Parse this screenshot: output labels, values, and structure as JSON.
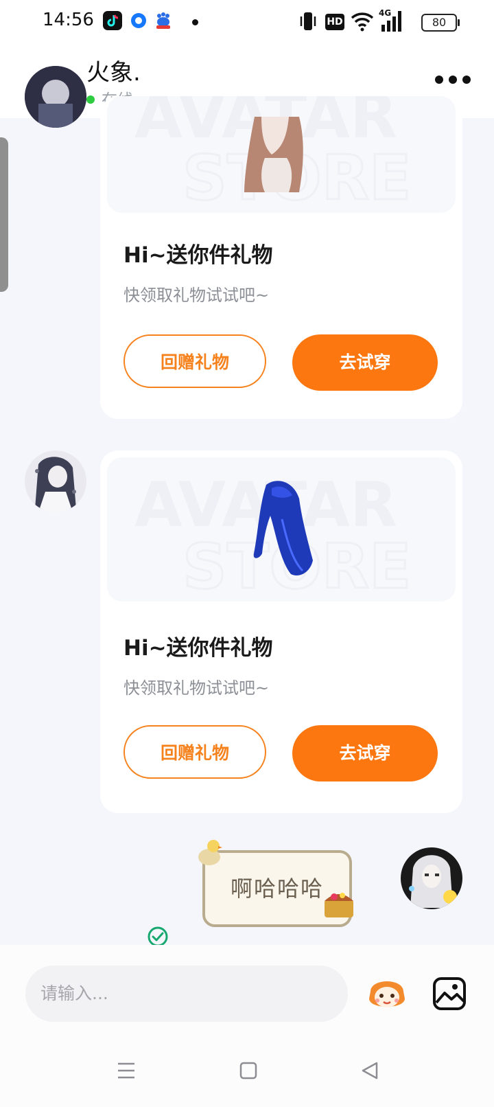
{
  "status_bar": {
    "time": "14:56",
    "battery": "80",
    "hd_label": "HD",
    "network_label": "4G"
  },
  "header": {
    "back_icon": "chevron-left-icon",
    "contact_name": "火象.",
    "status": "在线",
    "status_color": "#2ecc40",
    "more_icon": "more-dots-icon"
  },
  "messages": [
    {
      "type": "gift",
      "sender": "contact",
      "title": "Hi~送你件礼物",
      "subtitle": "快领取礼物试试吧~",
      "return_gift_label": "回赠礼物",
      "try_on_label": "去试穿",
      "item": "brown-hair"
    },
    {
      "type": "gift",
      "sender": "contact",
      "title": "Hi~送你件礼物",
      "subtitle": "快领取礼物试试吧~",
      "return_gift_label": "回赠礼物",
      "try_on_label": "去试穿",
      "item": "blue-hair"
    },
    {
      "type": "sticker-text",
      "sender": "me",
      "text": "啊哈哈哈",
      "sent_status_icon": "check-circle-icon"
    }
  ],
  "input": {
    "placeholder": "请输入..."
  },
  "colors": {
    "accent": "#fc770f",
    "outline_button": "#f6821e",
    "background": "#f4f6fb"
  }
}
